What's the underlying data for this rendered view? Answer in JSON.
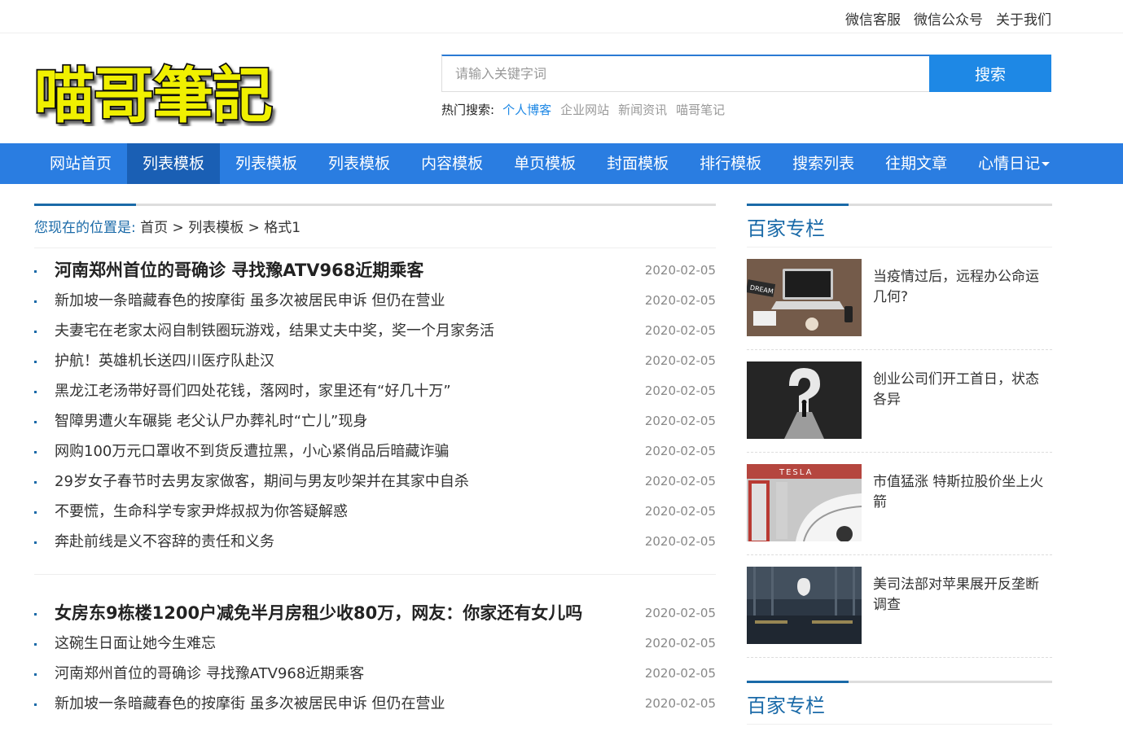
{
  "topbar": {
    "links": [
      "微信客服",
      "微信公众号",
      "关于我们"
    ]
  },
  "logo": {
    "text": "喵哥筆記"
  },
  "search": {
    "placeholder": "请输入关键字词",
    "button": "搜索"
  },
  "hot": {
    "label": "热门搜索:",
    "keywords": [
      "个人博客",
      "企业网站",
      "新闻资讯",
      "喵哥笔记"
    ]
  },
  "nav": {
    "items": [
      "网站首页",
      "列表模板",
      "列表模板",
      "列表模板",
      "内容模板",
      "单页模板",
      "封面模板",
      "排行模板",
      "搜索列表",
      "往期文章",
      "心情日记"
    ],
    "active_index": 1
  },
  "breadcrumb": {
    "label": "您现在的位置是:",
    "path": [
      "首页",
      "列表模板",
      "格式1"
    ],
    "sep": ">"
  },
  "list1": [
    {
      "title": "河南郑州首位的哥确诊 寻找豫ATV968近期乘客",
      "date": "2020-02-05"
    },
    {
      "title": "新加坡一条暗藏春色的按摩街 虽多次被居民申诉 但仍在营业",
      "date": "2020-02-05"
    },
    {
      "title": "夫妻宅在老家太闷自制铁圈玩游戏，结果丈夫中奖，奖一个月家务活",
      "date": "2020-02-05"
    },
    {
      "title": "护航！英雄机长送四川医疗队赴汉",
      "date": "2020-02-05"
    },
    {
      "title": "黑龙江老汤带好哥们四处花钱，落网时，家里还有“好几十万”",
      "date": "2020-02-05"
    },
    {
      "title": "智障男遭火车碾毙 老父认尸办葬礼时“亡儿”现身",
      "date": "2020-02-05"
    },
    {
      "title": "网购100万元口罩收不到货反遭拉黑，小心紧俏品后暗藏诈骗",
      "date": "2020-02-05"
    },
    {
      "title": "29岁女子春节时去男友家做客，期间与男友吵架并在其家中自杀",
      "date": "2020-02-05"
    },
    {
      "title": "不要慌，生命科学专家尹烨叔叔为你答疑解惑",
      "date": "2020-02-05"
    },
    {
      "title": "奔赴前线是义不容辞的责任和义务",
      "date": "2020-02-05"
    }
  ],
  "list2": [
    {
      "title": "女房东9栋楼1200户减免半月房租少收80万，网友：你家还有女儿吗",
      "date": "2020-02-05"
    },
    {
      "title": "这碗生日面让她今生难忘",
      "date": "2020-02-05"
    },
    {
      "title": "河南郑州首位的哥确诊 寻找豫ATV968近期乘客",
      "date": "2020-02-05"
    },
    {
      "title": "新加坡一条暗藏春色的按摩街 虽多次被居民申诉 但仍在营业",
      "date": "2020-02-05"
    }
  ],
  "sidebar": {
    "title": "百家专栏",
    "items": [
      {
        "text": "当疫情过后，远程办公命运几何?",
        "icon": "laptop-desk-photo"
      },
      {
        "text": "创业公司们开工首日，状态各异",
        "icon": "question-mark-photo"
      },
      {
        "text": "市值猛涨 特斯拉股价坐上火箭",
        "icon": "tesla-charger-photo",
        "sign": "TESLA"
      },
      {
        "text": "美司法部对苹果展开反垄断调查",
        "icon": "apple-store-photo"
      }
    ],
    "title2": "百家专栏"
  },
  "colors": {
    "nav": "#2a7de1",
    "nav_active": "#1a5fb4",
    "accent": "#1a6aa8",
    "button": "#1e88e5",
    "logo_fill": "#f0f000"
  }
}
